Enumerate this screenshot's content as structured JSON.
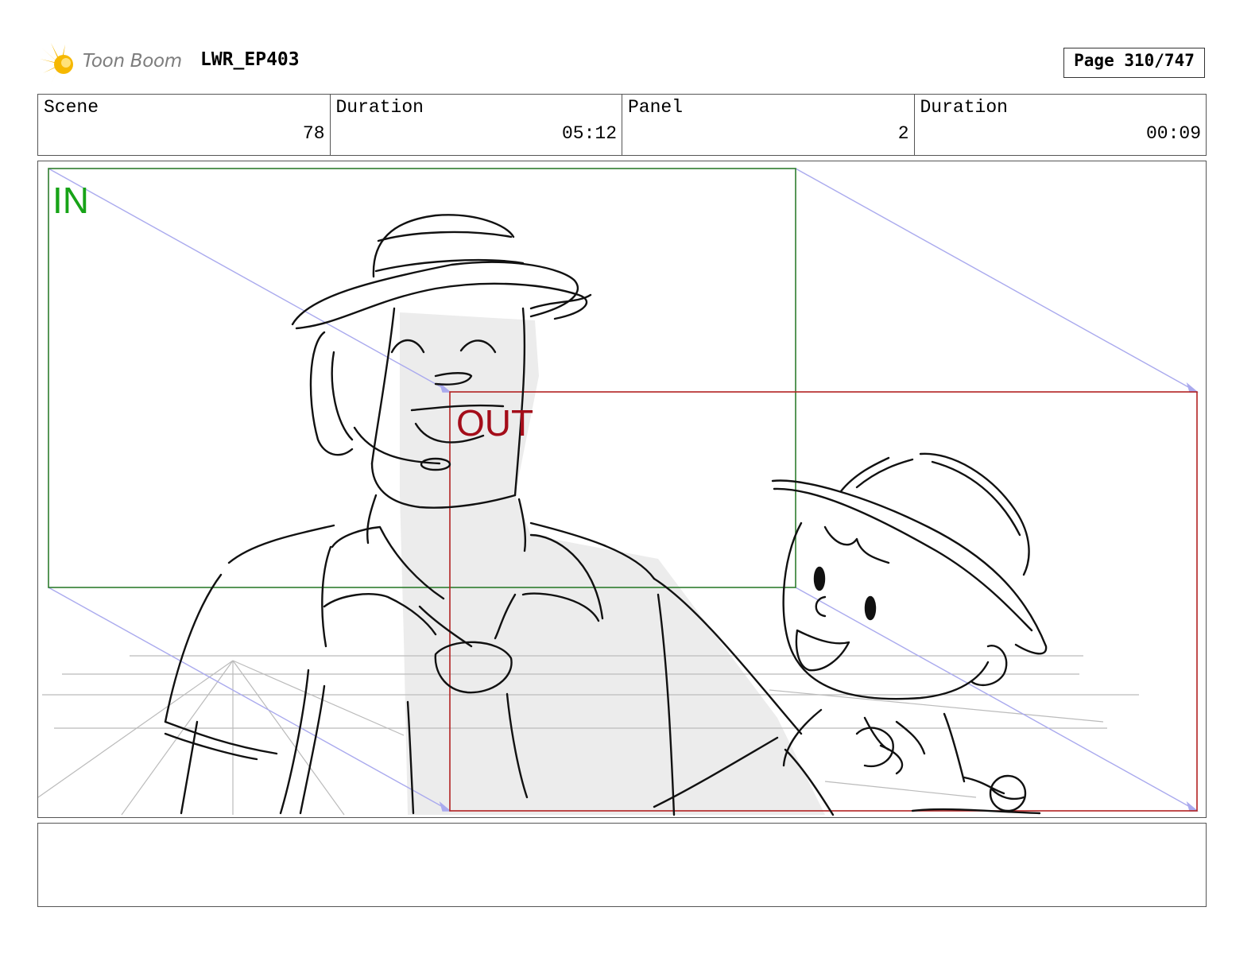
{
  "header": {
    "logo_text": "Toon Boom",
    "project": "LWR_EP403",
    "page": "Page 310/747"
  },
  "info": {
    "scene_label": "Scene",
    "scene_value": "78",
    "scene_duration_label": "Duration",
    "scene_duration_value": "05:12",
    "panel_label": "Panel",
    "panel_value": "2",
    "panel_duration_label": "Duration",
    "panel_duration_value": "00:09"
  },
  "frames": {
    "in_label": "IN",
    "out_label": "OUT",
    "in_color": "#17a317",
    "out_color": "#a40d1a",
    "motion_color": "#aaaaee"
  },
  "notes": {
    "text": ""
  }
}
